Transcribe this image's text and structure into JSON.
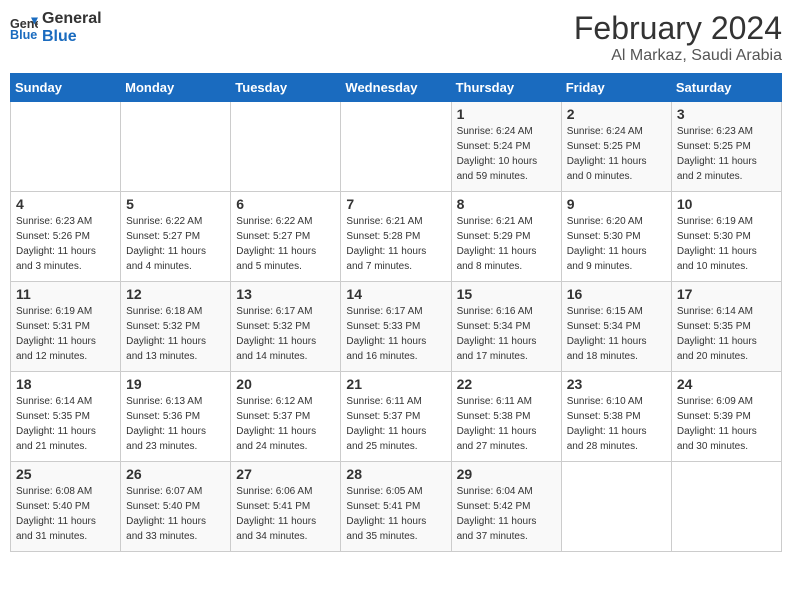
{
  "header": {
    "logo_line1": "General",
    "logo_line2": "Blue",
    "month_year": "February 2024",
    "location": "Al Markaz, Saudi Arabia"
  },
  "weekdays": [
    "Sunday",
    "Monday",
    "Tuesday",
    "Wednesday",
    "Thursday",
    "Friday",
    "Saturday"
  ],
  "weeks": [
    [
      {
        "day": "",
        "info": ""
      },
      {
        "day": "",
        "info": ""
      },
      {
        "day": "",
        "info": ""
      },
      {
        "day": "",
        "info": ""
      },
      {
        "day": "1",
        "info": "Sunrise: 6:24 AM\nSunset: 5:24 PM\nDaylight: 10 hours and 59 minutes."
      },
      {
        "day": "2",
        "info": "Sunrise: 6:24 AM\nSunset: 5:25 PM\nDaylight: 11 hours and 0 minutes."
      },
      {
        "day": "3",
        "info": "Sunrise: 6:23 AM\nSunset: 5:25 PM\nDaylight: 11 hours and 2 minutes."
      }
    ],
    [
      {
        "day": "4",
        "info": "Sunrise: 6:23 AM\nSunset: 5:26 PM\nDaylight: 11 hours and 3 minutes."
      },
      {
        "day": "5",
        "info": "Sunrise: 6:22 AM\nSunset: 5:27 PM\nDaylight: 11 hours and 4 minutes."
      },
      {
        "day": "6",
        "info": "Sunrise: 6:22 AM\nSunset: 5:27 PM\nDaylight: 11 hours and 5 minutes."
      },
      {
        "day": "7",
        "info": "Sunrise: 6:21 AM\nSunset: 5:28 PM\nDaylight: 11 hours and 7 minutes."
      },
      {
        "day": "8",
        "info": "Sunrise: 6:21 AM\nSunset: 5:29 PM\nDaylight: 11 hours and 8 minutes."
      },
      {
        "day": "9",
        "info": "Sunrise: 6:20 AM\nSunset: 5:30 PM\nDaylight: 11 hours and 9 minutes."
      },
      {
        "day": "10",
        "info": "Sunrise: 6:19 AM\nSunset: 5:30 PM\nDaylight: 11 hours and 10 minutes."
      }
    ],
    [
      {
        "day": "11",
        "info": "Sunrise: 6:19 AM\nSunset: 5:31 PM\nDaylight: 11 hours and 12 minutes."
      },
      {
        "day": "12",
        "info": "Sunrise: 6:18 AM\nSunset: 5:32 PM\nDaylight: 11 hours and 13 minutes."
      },
      {
        "day": "13",
        "info": "Sunrise: 6:17 AM\nSunset: 5:32 PM\nDaylight: 11 hours and 14 minutes."
      },
      {
        "day": "14",
        "info": "Sunrise: 6:17 AM\nSunset: 5:33 PM\nDaylight: 11 hours and 16 minutes."
      },
      {
        "day": "15",
        "info": "Sunrise: 6:16 AM\nSunset: 5:34 PM\nDaylight: 11 hours and 17 minutes."
      },
      {
        "day": "16",
        "info": "Sunrise: 6:15 AM\nSunset: 5:34 PM\nDaylight: 11 hours and 18 minutes."
      },
      {
        "day": "17",
        "info": "Sunrise: 6:14 AM\nSunset: 5:35 PM\nDaylight: 11 hours and 20 minutes."
      }
    ],
    [
      {
        "day": "18",
        "info": "Sunrise: 6:14 AM\nSunset: 5:35 PM\nDaylight: 11 hours and 21 minutes."
      },
      {
        "day": "19",
        "info": "Sunrise: 6:13 AM\nSunset: 5:36 PM\nDaylight: 11 hours and 23 minutes."
      },
      {
        "day": "20",
        "info": "Sunrise: 6:12 AM\nSunset: 5:37 PM\nDaylight: 11 hours and 24 minutes."
      },
      {
        "day": "21",
        "info": "Sunrise: 6:11 AM\nSunset: 5:37 PM\nDaylight: 11 hours and 25 minutes."
      },
      {
        "day": "22",
        "info": "Sunrise: 6:11 AM\nSunset: 5:38 PM\nDaylight: 11 hours and 27 minutes."
      },
      {
        "day": "23",
        "info": "Sunrise: 6:10 AM\nSunset: 5:38 PM\nDaylight: 11 hours and 28 minutes."
      },
      {
        "day": "24",
        "info": "Sunrise: 6:09 AM\nSunset: 5:39 PM\nDaylight: 11 hours and 30 minutes."
      }
    ],
    [
      {
        "day": "25",
        "info": "Sunrise: 6:08 AM\nSunset: 5:40 PM\nDaylight: 11 hours and 31 minutes."
      },
      {
        "day": "26",
        "info": "Sunrise: 6:07 AM\nSunset: 5:40 PM\nDaylight: 11 hours and 33 minutes."
      },
      {
        "day": "27",
        "info": "Sunrise: 6:06 AM\nSunset: 5:41 PM\nDaylight: 11 hours and 34 minutes."
      },
      {
        "day": "28",
        "info": "Sunrise: 6:05 AM\nSunset: 5:41 PM\nDaylight: 11 hours and 35 minutes."
      },
      {
        "day": "29",
        "info": "Sunrise: 6:04 AM\nSunset: 5:42 PM\nDaylight: 11 hours and 37 minutes."
      },
      {
        "day": "",
        "info": ""
      },
      {
        "day": "",
        "info": ""
      }
    ]
  ]
}
